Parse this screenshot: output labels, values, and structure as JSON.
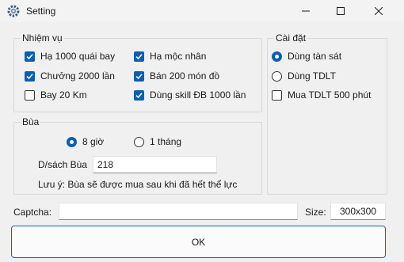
{
  "window": {
    "title": "Setting",
    "icon": "gear-icon",
    "controls": {
      "minimize": "minimize-icon",
      "maximize": "maximize-icon",
      "close": "close-icon"
    }
  },
  "nhiemvu": {
    "legend": "Nhiệm vụ",
    "items": [
      {
        "label": "Hạ 1000 quái bay",
        "checked": true
      },
      {
        "label": "Hạ mộc nhân",
        "checked": true
      },
      {
        "label": "Chưởng 2000 lần",
        "checked": true
      },
      {
        "label": "Bán 200 món đồ",
        "checked": true
      },
      {
        "label": "Bay 20 Km",
        "checked": false
      },
      {
        "label": "Dùng skill ĐB 1000 lần",
        "checked": true
      }
    ]
  },
  "caidat": {
    "legend": "Cài đặt",
    "radios": [
      {
        "label": "Dùng tàn sát",
        "selected": true
      },
      {
        "label": "Dùng TDLT",
        "selected": false
      }
    ],
    "check": {
      "label": "Mua TDLT 500 phút",
      "checked": false
    }
  },
  "bua": {
    "legend": "Bùa",
    "radios": [
      {
        "label": "8 giờ",
        "selected": true
      },
      {
        "label": "1 tháng",
        "selected": false
      }
    ],
    "list_label": "D/sách Bùa",
    "list_value": "218",
    "note": "Lưu ý: Bùa sẽ được mua sau khi đã hết thể lực"
  },
  "captcha": {
    "label": "Captcha:",
    "value": ""
  },
  "size": {
    "label": "Size:",
    "value": "300x300"
  },
  "ok_label": "OK",
  "colors": {
    "accent": "#0a5fb4",
    "background": "#f0f0f0",
    "ok_border": "#0067c0"
  }
}
